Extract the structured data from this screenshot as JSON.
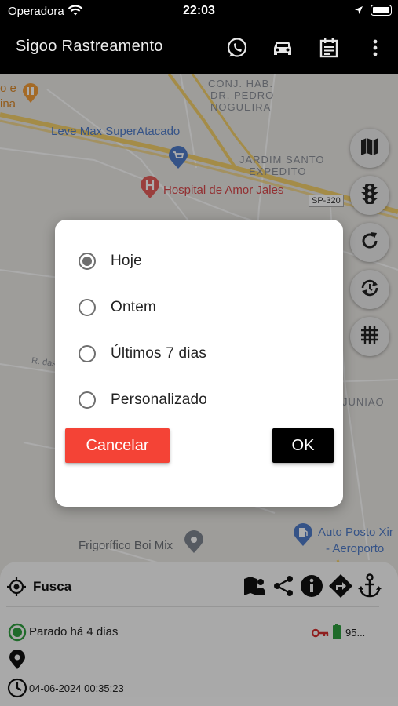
{
  "status_bar": {
    "carrier": "Operadora",
    "time": "22:03"
  },
  "app_bar": {
    "title": "Sigoo Rastreamento",
    "actions": [
      "whatsapp-icon",
      "car-icon",
      "calendar-icon",
      "more-vert-icon"
    ]
  },
  "map": {
    "areas": [
      "CONJ. HAB.",
      "DR. PEDRO",
      "NOGUEIRA",
      "JARDIM SANTO",
      "EXPEDITO",
      "JUNIAO"
    ],
    "pois": {
      "top_left_a": "o e",
      "top_left_b": "ina",
      "supermarket": "Leve Max SuperAtacado",
      "hospital": "Hospital de Amor Jales",
      "frigorifico": "Frigorífico Boi Mix",
      "posto_a": "Auto Posto Xir",
      "posto_b": "- Aeroporto"
    },
    "road_badge": "SP-320",
    "street": "R. das",
    "controls": [
      "map-icon",
      "traffic-light-icon",
      "refresh-icon",
      "auto-refresh-icon",
      "grid-icon"
    ]
  },
  "dialog": {
    "options": [
      {
        "label": "Hoje",
        "selected": true
      },
      {
        "label": "Ontem",
        "selected": false
      },
      {
        "label": "Últimos 7 dias",
        "selected": false
      },
      {
        "label": "Personalizado",
        "selected": false
      }
    ],
    "cancel_label": "Cancelar",
    "ok_label": "OK"
  },
  "vehicle": {
    "name": "Fusca",
    "status": "Parado há 4 dias",
    "battery": "95...",
    "datetime": "04-06-2024 00:35:23"
  },
  "colors": {
    "accent_red": "#f44336",
    "status_green": "#2e9e3e",
    "key_red": "#d32f2f"
  }
}
